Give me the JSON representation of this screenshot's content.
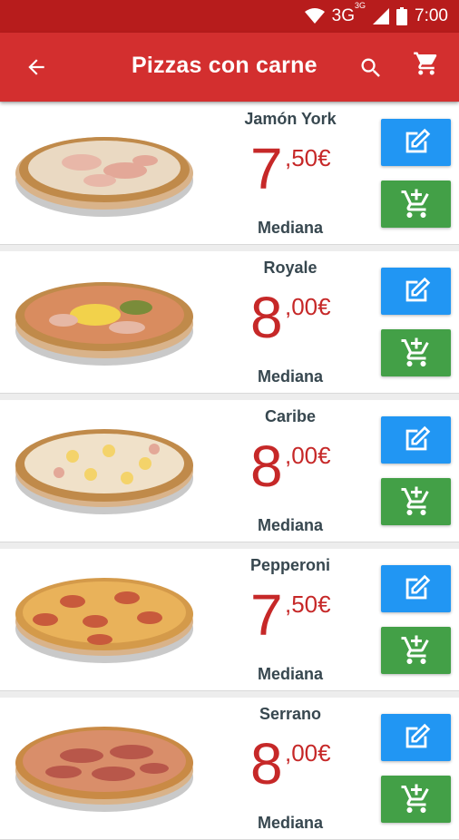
{
  "status_bar": {
    "network": "3G",
    "network_sup": "3G",
    "time": "7:00"
  },
  "app_bar": {
    "title": "Pizzas con carne"
  },
  "colors": {
    "primary": "#d32f2f",
    "status": "#b71c1c",
    "price": "#c62828",
    "edit": "#2196f3",
    "add": "#43a047"
  },
  "pizzas": [
    {
      "name": "Jamón York",
      "price_int": "7",
      "price_dec": ",50€",
      "size": "Mediana"
    },
    {
      "name": "Royale",
      "price_int": "8",
      "price_dec": ",00€",
      "size": "Mediana"
    },
    {
      "name": "Caribe",
      "price_int": "8",
      "price_dec": ",00€",
      "size": "Mediana"
    },
    {
      "name": "Pepperoni",
      "price_int": "7",
      "price_dec": ",50€",
      "size": "Mediana"
    },
    {
      "name": "Serrano",
      "price_int": "8",
      "price_dec": ",00€",
      "size": "Mediana"
    }
  ],
  "icons": {
    "back": "arrow-back-icon",
    "search": "search-icon",
    "cart": "cart-icon",
    "edit": "edit-icon",
    "add_to_cart": "add-shopping-cart-icon"
  }
}
